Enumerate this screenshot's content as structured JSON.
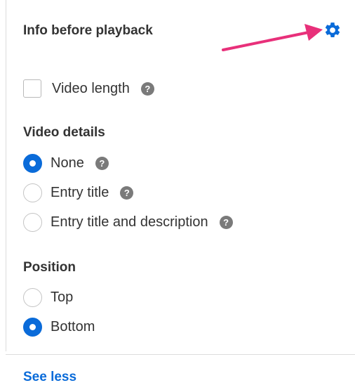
{
  "header": {
    "title": "Info before playback"
  },
  "options": {
    "video_length_label": "Video length",
    "video_length_checked": false
  },
  "video_details": {
    "title": "Video details",
    "items": [
      {
        "label": "None",
        "selected": true
      },
      {
        "label": "Entry title",
        "selected": false
      },
      {
        "label": "Entry title and description",
        "selected": false
      }
    ]
  },
  "position": {
    "title": "Position",
    "items": [
      {
        "label": "Top",
        "selected": false
      },
      {
        "label": "Bottom",
        "selected": true
      }
    ]
  },
  "footer": {
    "see_less_label": "See less"
  },
  "help_glyph": "?",
  "colors": {
    "accent": "#0a6bd9",
    "annotation_arrow": "#e8307a",
    "help_icon": "#7a7a7a"
  },
  "icons": {
    "settings": "gear-icon",
    "help": "help-icon",
    "annotation": "arrow-annotation"
  }
}
